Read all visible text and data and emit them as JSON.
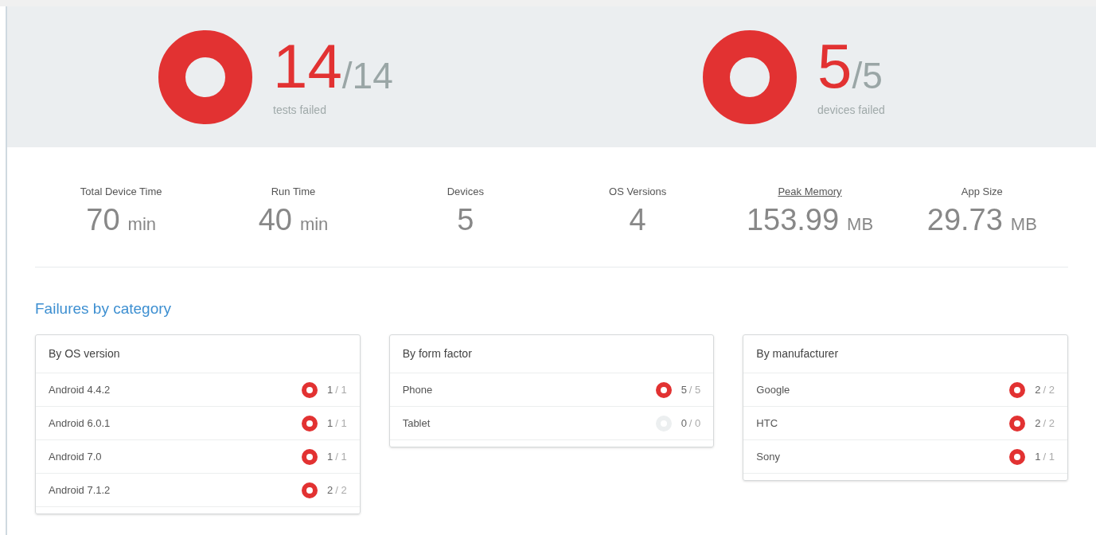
{
  "summaries": [
    {
      "failed": "14",
      "total": "/14",
      "label": "tests failed",
      "color": "#e23232"
    },
    {
      "failed": "5",
      "total": "/5",
      "label": "devices failed",
      "color": "#e23232"
    }
  ],
  "stats": [
    {
      "label": "Total Device Time",
      "value": "70",
      "unit": "min",
      "underlined": false
    },
    {
      "label": "Run Time",
      "value": "40",
      "unit": "min",
      "underlined": false
    },
    {
      "label": "Devices",
      "value": "5",
      "underlined": false
    },
    {
      "label": "OS Versions",
      "value": "4",
      "underlined": false
    },
    {
      "label": "Peak Memory",
      "value": "153.99",
      "unit": "MB",
      "underlined": true
    },
    {
      "label": "App Size",
      "value": "29.73",
      "unit": "MB",
      "underlined": false
    }
  ],
  "section_title": "Failures by category",
  "categories": [
    {
      "title": "By OS version",
      "rows": [
        {
          "name": "Android 4.4.2",
          "failed": "1",
          "total": "/ 1",
          "color": "#e23232"
        },
        {
          "name": "Android 6.0.1",
          "failed": "1",
          "total": "/ 1",
          "color": "#e23232"
        },
        {
          "name": "Android 7.0",
          "failed": "1",
          "total": "/ 1",
          "color": "#e23232"
        },
        {
          "name": "Android 7.1.2",
          "failed": "2",
          "total": "/ 2",
          "color": "#e23232"
        }
      ]
    },
    {
      "title": "By form factor",
      "rows": [
        {
          "name": "Phone",
          "failed": "5",
          "total": "/ 5",
          "color": "#e23232"
        },
        {
          "name": "Tablet",
          "failed": "0",
          "total": "/ 0",
          "color": "#eceff0"
        }
      ]
    },
    {
      "title": "By manufacturer",
      "rows": [
        {
          "name": "Google",
          "failed": "2",
          "total": "/ 2",
          "color": "#e23232"
        },
        {
          "name": "HTC",
          "failed": "2",
          "total": "/ 2",
          "color": "#e23232"
        },
        {
          "name": "Sony",
          "failed": "1",
          "total": "/ 1",
          "color": "#e23232"
        }
      ]
    }
  ]
}
